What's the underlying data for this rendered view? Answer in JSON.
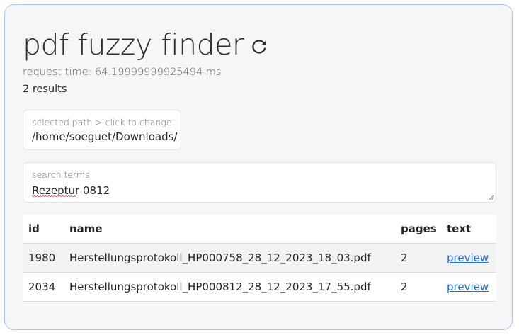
{
  "header": {
    "title": "pdf fuzzy finder",
    "refresh_icon": "refresh-icon"
  },
  "status": {
    "request_time": "request time: 64.19999999925494 ms",
    "results_count": "2 results"
  },
  "path_selector": {
    "label": "selected path > click to change",
    "value": "/home/soeguet/Downloads/"
  },
  "search": {
    "label": "search terms",
    "value": "Rezeptur 0812"
  },
  "table": {
    "headers": {
      "id": "id",
      "name": "name",
      "pages": "pages",
      "text": "text"
    },
    "rows": [
      {
        "id": "1980",
        "name": "Herstellungsprotokoll_HP000758_28_12_2023_18_03.pdf",
        "pages": "2",
        "text": "preview"
      },
      {
        "id": "2034",
        "name": "Herstellungsprotokoll_HP000812_28_12_2023_17_55.pdf",
        "pages": "2",
        "text": "preview"
      }
    ]
  },
  "colors": {
    "accent_link": "#1e6fd9",
    "card_border": "#a9c3ea",
    "card_background": "#f5f6f8"
  }
}
